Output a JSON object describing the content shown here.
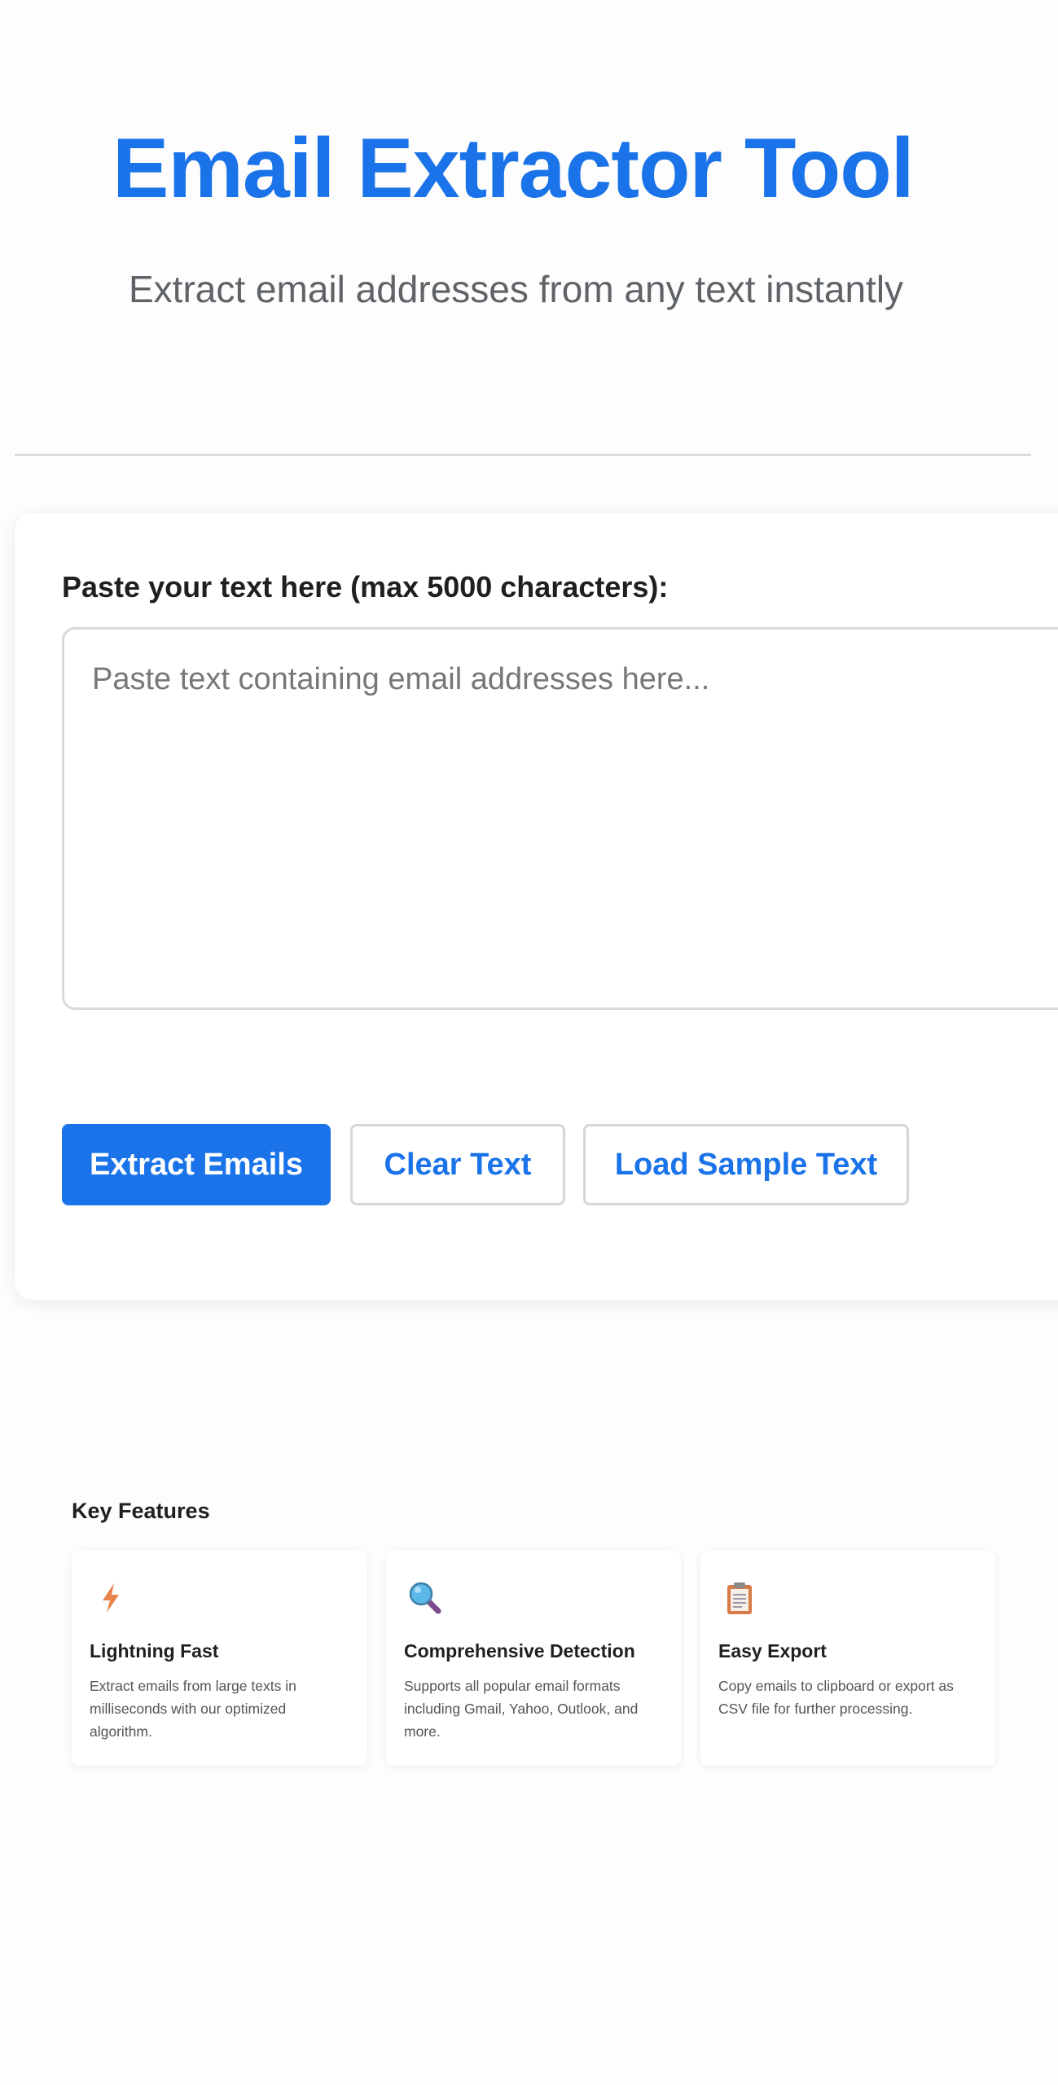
{
  "header": {
    "title": "Email Extractor Tool",
    "subtitle": "Extract email addresses from any text instantly"
  },
  "input": {
    "label": "Paste your text here (max 5000 characters):",
    "placeholder": "Paste text containing email addresses here...",
    "value": ""
  },
  "actions": {
    "extract_label": "Extract Emails",
    "clear_label": "Clear Text",
    "sample_label": "Load Sample Text"
  },
  "features": {
    "heading": "Key Features",
    "items": [
      {
        "icon": "lightning-icon",
        "title": "Lightning Fast",
        "description": "Extract emails from large texts in milliseconds with our optimized algorithm."
      },
      {
        "icon": "magnifier-icon",
        "title": "Comprehensive Detection",
        "description": "Supports all popular email formats including Gmail, Yahoo, Outlook, and more."
      },
      {
        "icon": "clipboard-icon",
        "title": "Easy Export",
        "description": "Copy emails to clipboard or export as CSV file for further processing."
      }
    ]
  },
  "colors": {
    "accent": "#1a73e8",
    "lightning": "#e8834a",
    "magnifier_lens": "#5bb8e8",
    "magnifier_handle": "#7a4a8a",
    "clipboard": "#d97a4a"
  }
}
